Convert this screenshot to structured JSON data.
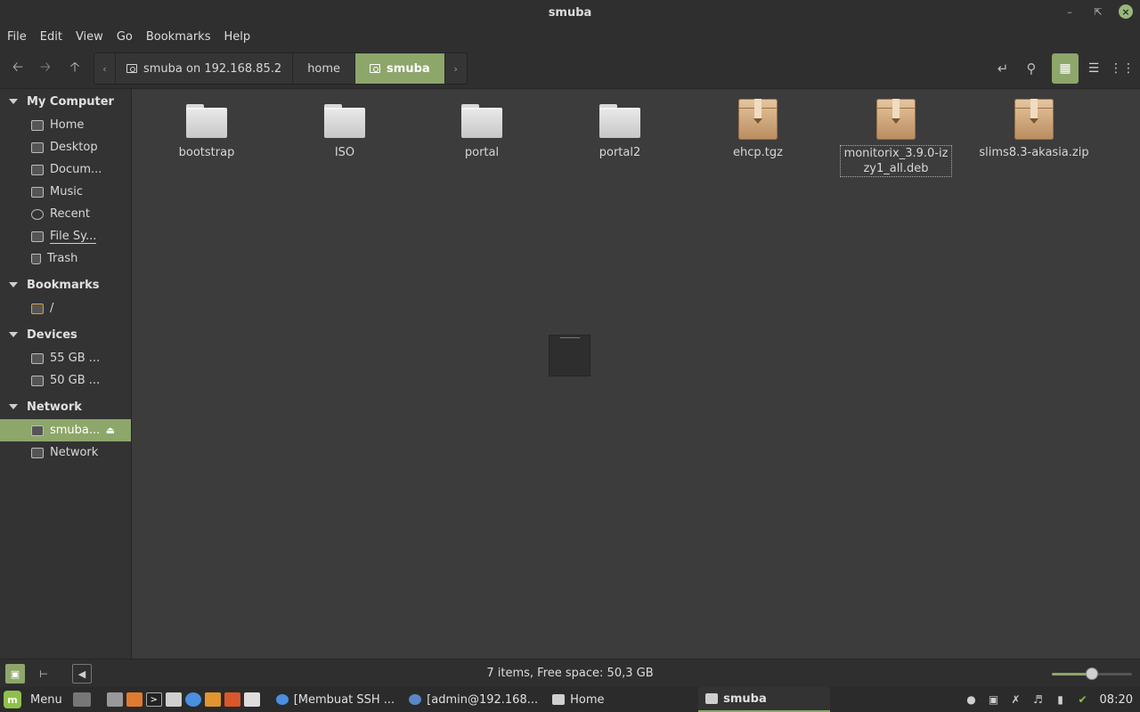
{
  "window": {
    "title": "smuba"
  },
  "menubar": [
    "File",
    "Edit",
    "View",
    "Go",
    "Bookmarks",
    "Help"
  ],
  "pathbar": {
    "segments": [
      "smuba on 192.168.85.2",
      "home",
      "smuba"
    ],
    "active": "smuba"
  },
  "sidebar": {
    "sections": [
      {
        "title": "My Computer",
        "items": [
          "Home",
          "Desktop",
          "Docum...",
          "Music",
          "Recent",
          "File Sy...",
          "Trash"
        ]
      },
      {
        "title": "Bookmarks",
        "items": [
          "/"
        ]
      },
      {
        "title": "Devices",
        "items": [
          "55 GB ...",
          "50 GB ..."
        ]
      },
      {
        "title": "Network",
        "items": [
          "smuba...",
          "Network"
        ]
      }
    ],
    "selected": "smuba..."
  },
  "files": [
    {
      "name": "bootstrap",
      "type": "folder"
    },
    {
      "name": "ISO",
      "type": "folder"
    },
    {
      "name": "portal",
      "type": "folder"
    },
    {
      "name": "portal2",
      "type": "folder"
    },
    {
      "name": "ehcp.tgz",
      "type": "archive"
    },
    {
      "name": "monitorix_3.9.0-izzy1_all.deb",
      "type": "archive"
    },
    {
      "name": "slims8.3-akasia.zip",
      "type": "archive"
    }
  ],
  "status": {
    "text": "7 items, Free space: 50,3 GB",
    "zoom_level": 0.5
  },
  "taskbar": {
    "menu_label": "Menu",
    "tasks": [
      {
        "label": "[Membuat SSH ..."
      },
      {
        "label": "[admin@192.168..."
      },
      {
        "label": "Home"
      },
      {
        "label": "smuba"
      }
    ],
    "active_task": "smuba",
    "clock": "08:20"
  },
  "colors": {
    "accent": "#8da66a",
    "background": "#3c3c3c",
    "panel": "#2f2f2f"
  }
}
